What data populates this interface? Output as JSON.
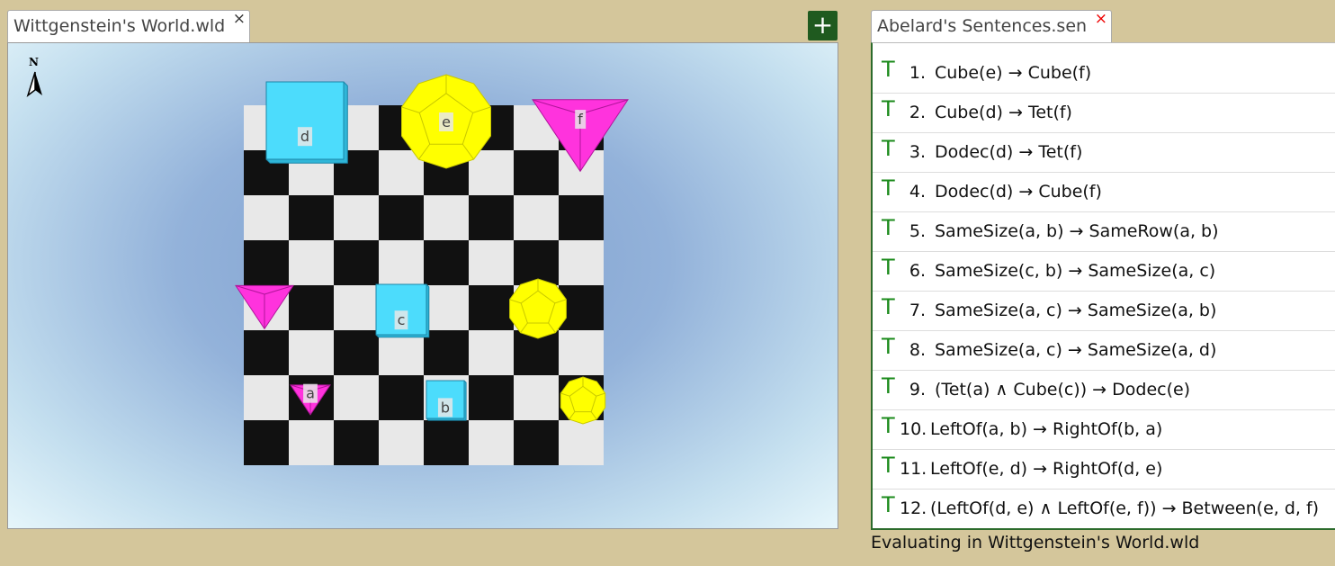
{
  "world_tab": {
    "title": "Wittgenstein's World.wld",
    "close": "×"
  },
  "add_button": {
    "label": "+"
  },
  "sentences_tab": {
    "title": "Abelard's Sentences.sen",
    "close": "×"
  },
  "compass": {
    "label": "N"
  },
  "world": {
    "board": {
      "light": "#e8e8e8",
      "dark": "#111111"
    },
    "colors": {
      "cube": "#4cdcfc",
      "tet": "#ff33dd",
      "dodec": "#ffff00"
    },
    "objects": [
      {
        "shape": "cube",
        "size": "large",
        "label": "d"
      },
      {
        "shape": "dodec",
        "size": "large",
        "label": "e"
      },
      {
        "shape": "tet",
        "size": "large",
        "label": "f"
      },
      {
        "shape": "tet",
        "size": "medium",
        "label": ""
      },
      {
        "shape": "cube",
        "size": "medium",
        "label": "c"
      },
      {
        "shape": "dodec",
        "size": "medium",
        "label": ""
      },
      {
        "shape": "tet",
        "size": "small",
        "label": "a"
      },
      {
        "shape": "cube",
        "size": "small",
        "label": "b"
      },
      {
        "shape": "dodec",
        "size": "small",
        "label": ""
      }
    ]
  },
  "sentences": [
    {
      "value": "T",
      "num": "1.",
      "text": "Cube(e) → Cube(f)"
    },
    {
      "value": "T",
      "num": "2.",
      "text": "Cube(d) → Tet(f)"
    },
    {
      "value": "T",
      "num": "3.",
      "text": "Dodec(d) → Tet(f)"
    },
    {
      "value": "T",
      "num": "4.",
      "text": "Dodec(d) → Cube(f)"
    },
    {
      "value": "T",
      "num": "5.",
      "text": "SameSize(a, b) → SameRow(a, b)"
    },
    {
      "value": "T",
      "num": "6.",
      "text": "SameSize(c, b) → SameSize(a, c)"
    },
    {
      "value": "T",
      "num": "7.",
      "text": "SameSize(a, c) → SameSize(a, b)"
    },
    {
      "value": "T",
      "num": "8.",
      "text": "SameSize(a, c) → SameSize(a, d)"
    },
    {
      "value": "T",
      "num": "9.",
      "text": "(Tet(a) ∧ Cube(c)) → Dodec(e)"
    },
    {
      "value": "T",
      "num": "10.",
      "text": "LeftOf(a, b) → RightOf(b, a)"
    },
    {
      "value": "T",
      "num": "11.",
      "text": "LeftOf(e, d) → RightOf(d, e)"
    },
    {
      "value": "T",
      "num": "12.",
      "text": "(LeftOf(d, e) ∧ LeftOf(e, f)) → Between(e, d, f)"
    }
  ],
  "status": "Evaluating in Wittgenstein's World.wld"
}
